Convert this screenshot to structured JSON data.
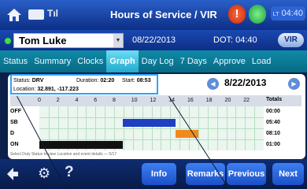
{
  "header": {
    "title": "Hours of Service / VIR",
    "clock": "04:40",
    "clock_prefix": "LT",
    "alert_glyph": "!"
  },
  "driver": {
    "name": "Tom Luke",
    "date": "08/22/2013",
    "dot_label": "DOT: 04:40",
    "vir_label": "VIR"
  },
  "tabs": [
    "Status",
    "Summary",
    "Clocks",
    "Graph",
    "Day Log",
    "7 Days",
    "Approve",
    "Load"
  ],
  "active_tab": "Graph",
  "graph": {
    "status_label": "Status:",
    "status_value": "DRV",
    "duration_label": "Duration:",
    "duration_value": "02:20",
    "start_label": "Start:",
    "start_value": "08:53",
    "location_label": "Location:",
    "location_value": "32.891, -117.223",
    "date": "8/22/2013",
    "hours": [
      "0",
      "2",
      "4",
      "6",
      "8",
      "10",
      "12",
      "14",
      "16",
      "18",
      "20",
      "22"
    ],
    "totals_label": "Totals",
    "rows": [
      {
        "label": "OFF",
        "total": "00:00"
      },
      {
        "label": "SB",
        "total": "05:40"
      },
      {
        "label": "D",
        "total": "08:10"
      },
      {
        "label": "ON",
        "total": "01:00"
      }
    ],
    "footer": "Select Duty Status to view Location and event details — 5/17",
    "colors": {
      "sb": "#1e3fc2",
      "d": "#f08a1e",
      "on": "#111111",
      "grid": "#eaf6ee"
    }
  },
  "buttons": {
    "info": "Info",
    "remarks": "Remarks",
    "previous": "Previous",
    "next": "Next"
  },
  "icons": [
    "home-icon",
    "hos-icon",
    "signal-icon",
    "alert-icon",
    "message-icon",
    "back-icon",
    "gear-icon",
    "help-icon"
  ]
}
